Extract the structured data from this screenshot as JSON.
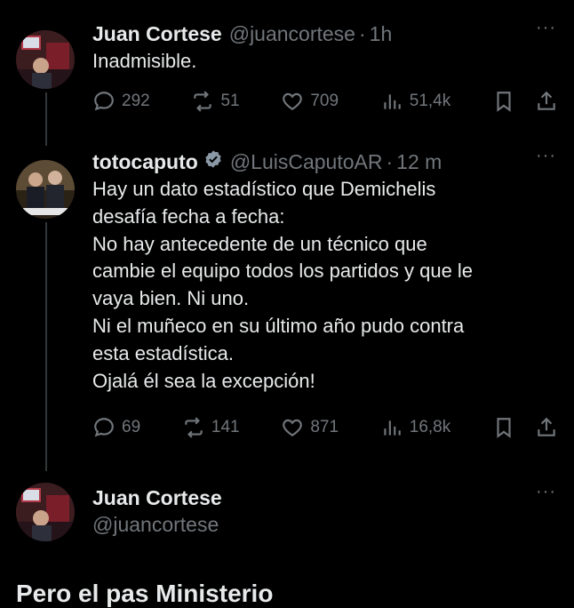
{
  "posts": [
    {
      "name": "Juan Cortese",
      "handle": "@juancortese",
      "separator": "·",
      "time": "1h",
      "text": "Inadmisible.",
      "more": "···",
      "replies": "292",
      "reposts": "51",
      "likes": "709",
      "views": "51,4k"
    },
    {
      "name": "totocaputo",
      "handle": "@LuisCaputoAR",
      "separator": "·",
      "time": "12 m",
      "verified": true,
      "text": "Hay un dato estadístico que Demichelis\ndesafía fecha a fecha:\nNo hay antecedente de un técnico que\ncambie el equipo todos los partidos y que le\nvaya bien. Ni uno.\nNi el muñeco en su último año pudo contra\nesta estadística.\nOjalá él sea la excepción!",
      "more": "···",
      "replies": "69",
      "reposts": "141",
      "likes": "871",
      "views": "16,8k"
    }
  ],
  "reply": {
    "name": "Juan Cortese",
    "handle": "@juancortese",
    "more": "···",
    "partial_text": "Pero el pas Ministerio"
  },
  "colors": {
    "background": "#000000",
    "text": "#e7e9ea",
    "muted": "#71767b",
    "verified": "#1d9bf0"
  },
  "icons": [
    "reply-icon",
    "repost-icon",
    "like-icon",
    "views-icon",
    "bookmark-icon",
    "share-icon",
    "verified-badge-icon",
    "more-icon"
  ]
}
